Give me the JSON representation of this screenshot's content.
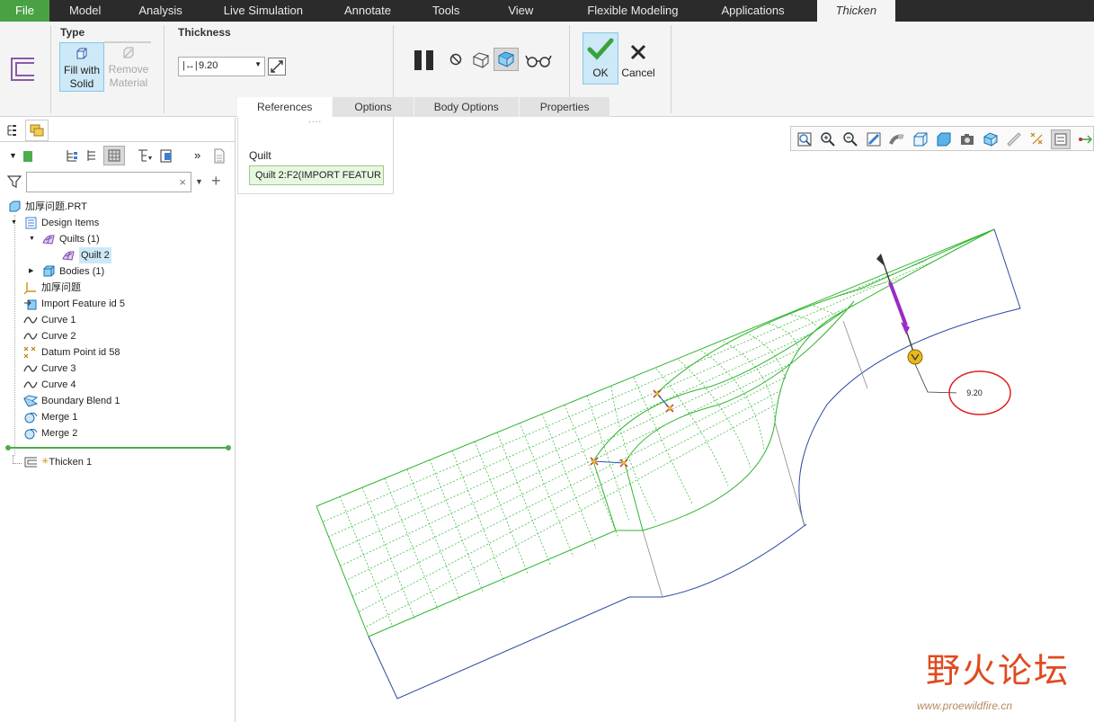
{
  "menu": {
    "tabs": [
      "File",
      "Model",
      "Analysis",
      "Live Simulation",
      "Annotate",
      "Tools",
      "View",
      "Flexible Modeling",
      "Applications"
    ],
    "active_tab": "Thicken"
  },
  "ribbon": {
    "type_label": "Type",
    "fill_solid_line1": "Fill with",
    "fill_solid_line2": "Solid",
    "remove_material_line1": "Remove",
    "remove_material_line2": "Material",
    "thickness_label": "Thickness",
    "thickness_value": "9.20",
    "ok_label": "OK",
    "cancel_label": "Cancel",
    "subtabs": [
      "References",
      "Options",
      "Body Options",
      "Properties"
    ]
  },
  "references_panel": {
    "handle": "....",
    "quilt_label": "Quilt",
    "quilt_value": "Quilt 2:F2(IMPORT FEATUR"
  },
  "model_tree": {
    "search_placeholder": "",
    "root": "加厚问题.PRT",
    "items": [
      {
        "label": "Design Items",
        "icon": "design-items-icon"
      },
      {
        "label": "Quilts (1)",
        "icon": "quilt-icon"
      },
      {
        "label": "Quilt 2",
        "icon": "quilt-icon"
      },
      {
        "label": "Bodies (1)",
        "icon": "body-icon"
      },
      {
        "label": "加厚问题",
        "icon": "coordinate-system-icon"
      },
      {
        "label": "Import Feature id 5",
        "icon": "import-feature-icon"
      },
      {
        "label": "Curve 1",
        "icon": "curve-icon"
      },
      {
        "label": "Curve 2",
        "icon": "curve-icon"
      },
      {
        "label": "Datum Point id 58",
        "icon": "datum-point-icon"
      },
      {
        "label": "Curve 3",
        "icon": "curve-icon"
      },
      {
        "label": "Curve 4",
        "icon": "curve-icon"
      },
      {
        "label": "Boundary Blend 1",
        "icon": "boundary-blend-icon"
      },
      {
        "label": "Merge 1",
        "icon": "merge-icon"
      },
      {
        "label": "Merge 2",
        "icon": "merge-icon"
      }
    ],
    "insert_item": "Thicken 1"
  },
  "graphics": {
    "dimension_value": "9.20"
  },
  "watermark": {
    "text": "野火论坛",
    "url": "www.proewildfire.cn"
  },
  "colors": {
    "menubar_bg": "#2b2b2b",
    "file_tab": "#49a144",
    "ribbon_bg": "#f4f4f4",
    "quilt_edge": "#2fb52f",
    "solid_edge": "#2a4aa0",
    "selection": "#cde8f7",
    "drag_handle": "#e8b820",
    "arrow": "#9b2bc4",
    "dimension_circle": "#e02020"
  }
}
